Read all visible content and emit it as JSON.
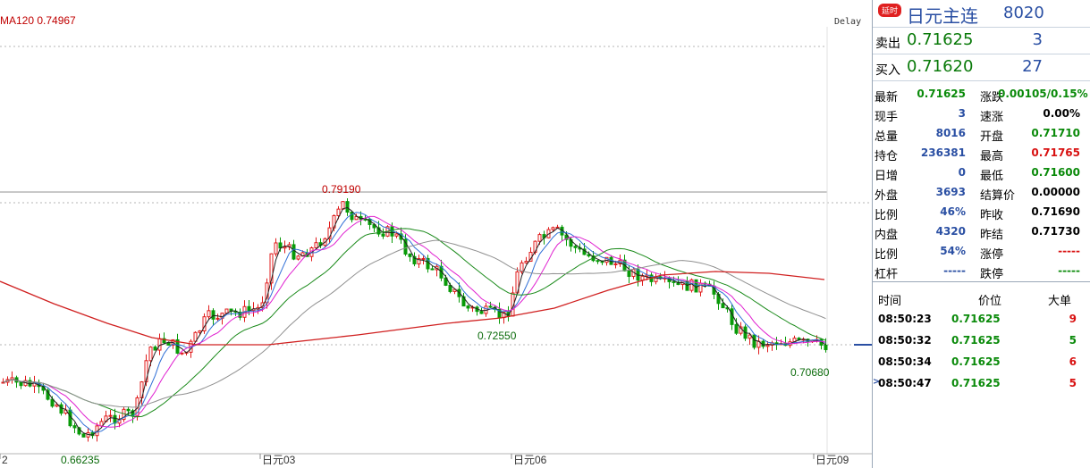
{
  "chart_header": {
    "ma_label": "MA120 0.74967",
    "delay_label": "Delay"
  },
  "chart_annotations": {
    "high": "0.79190",
    "mid_low": "0.72550",
    "low": "0.66235",
    "recent_low": "0.70680"
  },
  "x_labels": [
    "2",
    "日元03",
    "日元06",
    "日元09"
  ],
  "colors": {
    "up": "#e01b1b",
    "down": "#089a08",
    "ma_black": "#202020",
    "ma_blue": "#2f6fd6",
    "ma_magenta": "#e020d0",
    "ma_green": "#1a8a1a",
    "ma_gray": "#909090",
    "ma_red": "#d02020"
  },
  "panel": {
    "badge": "延时",
    "title": "日元主连",
    "code": "8020",
    "sell_label": "卖出",
    "sell_price": "0.71625",
    "sell_vol": "3",
    "buy_label": "买入",
    "buy_price": "0.71620",
    "buy_vol": "27",
    "stats": [
      {
        "l1": "最新",
        "v1": "0.71625",
        "c1": "green",
        "l2": "涨跌",
        "v2": "0.00105/0.15%",
        "c2": "green"
      },
      {
        "l1": "现手",
        "v1": "3",
        "c1": "blue",
        "l2": "速涨",
        "v2": "0.00%",
        "c2": "black"
      },
      {
        "l1": "总量",
        "v1": "8016",
        "c1": "blue",
        "l2": "开盘",
        "v2": "0.71710",
        "c2": "green"
      },
      {
        "l1": "持仓",
        "v1": "236381",
        "c1": "blue",
        "l2": "最高",
        "v2": "0.71765",
        "c2": "red"
      },
      {
        "l1": "日增",
        "v1": "0",
        "c1": "blue",
        "l2": "最低",
        "v2": "0.71600",
        "c2": "green"
      },
      {
        "l1": "外盘",
        "v1": "3693",
        "c1": "blue",
        "l2": "结算价",
        "v2": "0.00000",
        "c2": "black"
      },
      {
        "l1": "比例",
        "v1": "46%",
        "c1": "blue",
        "l2": "昨收",
        "v2": "0.71690",
        "c2": "black"
      },
      {
        "l1": "内盘",
        "v1": "4320",
        "c1": "blue",
        "l2": "昨结",
        "v2": "0.71730",
        "c2": "black"
      },
      {
        "l1": "比例",
        "v1": "54%",
        "c1": "blue",
        "l2": "涨停",
        "v2": "-----",
        "c2": "red"
      },
      {
        "l1": "杠杆",
        "v1": "-----",
        "c1": "blue",
        "l2": "跌停",
        "v2": "-----",
        "c2": "green"
      }
    ],
    "tick_headers": {
      "time": "时间",
      "price": "价位",
      "size": "大单"
    },
    "ticks": [
      {
        "time": "08:50:23",
        "price": "0.71625",
        "size": "9",
        "sc": "red"
      },
      {
        "time": "08:50:32",
        "price": "0.71625",
        "size": "5",
        "sc": "green"
      },
      {
        "time": "08:50:34",
        "price": "0.71625",
        "size": "6",
        "sc": "red"
      },
      {
        "time": "08:50:47",
        "price": "0.71625",
        "size": "5",
        "sc": "red"
      }
    ]
  }
}
